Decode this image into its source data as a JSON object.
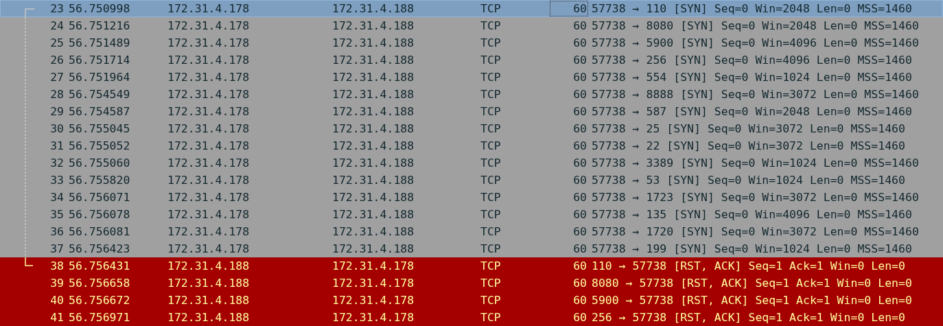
{
  "packets": [
    {
      "no": "23",
      "time": "56.750998",
      "source": "172.31.4.178",
      "destination": "172.31.4.188",
      "protocol": "TCP",
      "length": "60",
      "info": "57738 → 110 [SYN] Seq=0 Win=2048 Len=0 MSS=1460",
      "kind": "syn",
      "selected": true,
      "related": true
    },
    {
      "no": "24",
      "time": "56.751216",
      "source": "172.31.4.178",
      "destination": "172.31.4.188",
      "protocol": "TCP",
      "length": "60",
      "info": "57738 → 8080 [SYN] Seq=0 Win=2048 Len=0 MSS=1460",
      "kind": "syn",
      "selected": false,
      "related": true
    },
    {
      "no": "25",
      "time": "56.751489",
      "source": "172.31.4.178",
      "destination": "172.31.4.188",
      "protocol": "TCP",
      "length": "60",
      "info": "57738 → 5900 [SYN] Seq=0 Win=4096 Len=0 MSS=1460",
      "kind": "syn",
      "selected": false,
      "related": true
    },
    {
      "no": "26",
      "time": "56.751714",
      "source": "172.31.4.178",
      "destination": "172.31.4.188",
      "protocol": "TCP",
      "length": "60",
      "info": "57738 → 256 [SYN] Seq=0 Win=4096 Len=0 MSS=1460",
      "kind": "syn",
      "selected": false,
      "related": true
    },
    {
      "no": "27",
      "time": "56.751964",
      "source": "172.31.4.178",
      "destination": "172.31.4.188",
      "protocol": "TCP",
      "length": "60",
      "info": "57738 → 554 [SYN] Seq=0 Win=1024 Len=0 MSS=1460",
      "kind": "syn",
      "selected": false,
      "related": true
    },
    {
      "no": "28",
      "time": "56.754549",
      "source": "172.31.4.178",
      "destination": "172.31.4.188",
      "protocol": "TCP",
      "length": "60",
      "info": "57738 → 8888 [SYN] Seq=0 Win=3072 Len=0 MSS=1460",
      "kind": "syn",
      "selected": false,
      "related": true
    },
    {
      "no": "29",
      "time": "56.754587",
      "source": "172.31.4.178",
      "destination": "172.31.4.188",
      "protocol": "TCP",
      "length": "60",
      "info": "57738 → 587 [SYN] Seq=0 Win=2048 Len=0 MSS=1460",
      "kind": "syn",
      "selected": false,
      "related": true
    },
    {
      "no": "30",
      "time": "56.755045",
      "source": "172.31.4.178",
      "destination": "172.31.4.188",
      "protocol": "TCP",
      "length": "60",
      "info": "57738 → 25 [SYN] Seq=0 Win=3072 Len=0 MSS=1460",
      "kind": "syn",
      "selected": false,
      "related": true
    },
    {
      "no": "31",
      "time": "56.755052",
      "source": "172.31.4.178",
      "destination": "172.31.4.188",
      "protocol": "TCP",
      "length": "60",
      "info": "57738 → 22 [SYN] Seq=0 Win=3072 Len=0 MSS=1460",
      "kind": "syn",
      "selected": false,
      "related": true
    },
    {
      "no": "32",
      "time": "56.755060",
      "source": "172.31.4.178",
      "destination": "172.31.4.188",
      "protocol": "TCP",
      "length": "60",
      "info": "57738 → 3389 [SYN] Seq=0 Win=1024 Len=0 MSS=1460",
      "kind": "syn",
      "selected": false,
      "related": true
    },
    {
      "no": "33",
      "time": "56.755820",
      "source": "172.31.4.178",
      "destination": "172.31.4.188",
      "protocol": "TCP",
      "length": "60",
      "info": "57738 → 53 [SYN] Seq=0 Win=1024 Len=0 MSS=1460",
      "kind": "syn",
      "selected": false,
      "related": true
    },
    {
      "no": "34",
      "time": "56.756071",
      "source": "172.31.4.178",
      "destination": "172.31.4.188",
      "protocol": "TCP",
      "length": "60",
      "info": "57738 → 1723 [SYN] Seq=0 Win=3072 Len=0 MSS=1460",
      "kind": "syn",
      "selected": false,
      "related": true
    },
    {
      "no": "35",
      "time": "56.756078",
      "source": "172.31.4.178",
      "destination": "172.31.4.188",
      "protocol": "TCP",
      "length": "60",
      "info": "57738 → 135 [SYN] Seq=0 Win=4096 Len=0 MSS=1460",
      "kind": "syn",
      "selected": false,
      "related": true
    },
    {
      "no": "36",
      "time": "56.756081",
      "source": "172.31.4.178",
      "destination": "172.31.4.188",
      "protocol": "TCP",
      "length": "60",
      "info": "57738 → 1720 [SYN] Seq=0 Win=3072 Len=0 MSS=1460",
      "kind": "syn",
      "selected": false,
      "related": true
    },
    {
      "no": "37",
      "time": "56.756423",
      "source": "172.31.4.178",
      "destination": "172.31.4.188",
      "protocol": "TCP",
      "length": "60",
      "info": "57738 → 199 [SYN] Seq=0 Win=1024 Len=0 MSS=1460",
      "kind": "syn",
      "selected": false,
      "related": true
    },
    {
      "no": "38",
      "time": "56.756431",
      "source": "172.31.4.188",
      "destination": "172.31.4.178",
      "protocol": "TCP",
      "length": "60",
      "info": "110 → 57738 [RST, ACK] Seq=1 Ack=1 Win=0 Len=0",
      "kind": "rst",
      "selected": false,
      "related": true
    },
    {
      "no": "39",
      "time": "56.756658",
      "source": "172.31.4.188",
      "destination": "172.31.4.178",
      "protocol": "TCP",
      "length": "60",
      "info": "8080 → 57738 [RST, ACK] Seq=1 Ack=1 Win=0 Len=0",
      "kind": "rst",
      "selected": false,
      "related": false
    },
    {
      "no": "40",
      "time": "56.756672",
      "source": "172.31.4.188",
      "destination": "172.31.4.178",
      "protocol": "TCP",
      "length": "60",
      "info": "5900 → 57738 [RST, ACK] Seq=1 Ack=1 Win=0 Len=0",
      "kind": "rst",
      "selected": false,
      "related": false
    },
    {
      "no": "41",
      "time": "56.756971",
      "source": "172.31.4.188",
      "destination": "172.31.4.178",
      "protocol": "TCP",
      "length": "60",
      "info": "256 → 57738 [RST, ACK] Seq=1 Ack=1 Win=0 Len=0",
      "kind": "rst",
      "selected": false,
      "related": false
    }
  ]
}
